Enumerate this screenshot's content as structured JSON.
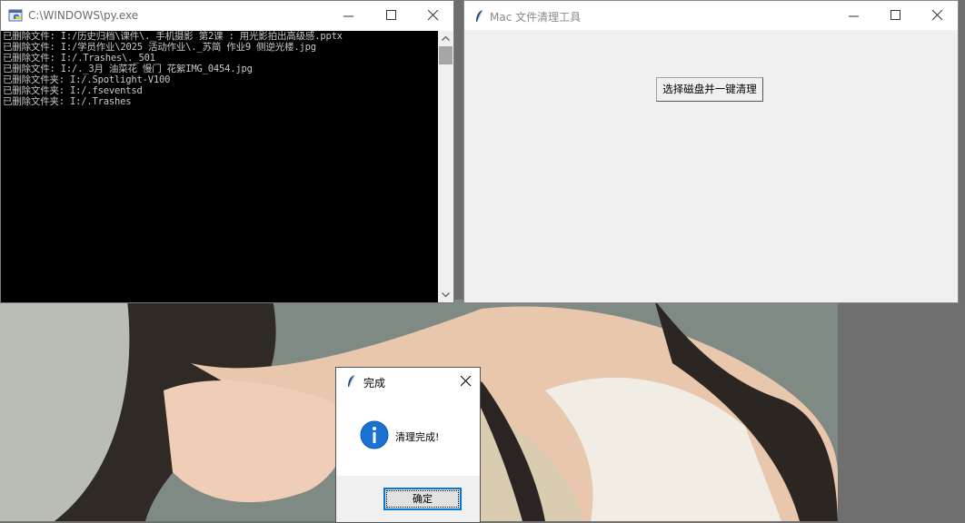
{
  "console": {
    "title": "C:\\WINDOWS\\py.exe",
    "lines": [
      "已删除文件: I:/历史归档\\课件\\._手机摄影 第2课 : 用光影拍出高级感.pptx",
      "已删除文件: I:/学员作业\\2025 活动作业\\._苏简 作业9 侧逆光楼.jpg",
      "已删除文件: I:/.Trashes\\._501",
      "已删除文件: I:/._3月 油菜花 慢门 花絮IMG_0454.jpg",
      "已删除文件夹: I:/.Spotlight-V100",
      "已删除文件夹: I:/.fseventsd",
      "已删除文件夹: I:/.Trashes"
    ],
    "icons": {
      "app": "python-console-icon",
      "minimize": "minimize-icon",
      "maximize": "maximize-icon",
      "close": "close-icon"
    }
  },
  "tool": {
    "title": "Mac 文件清理工具",
    "button_label": "选择磁盘并一键清理",
    "icons": {
      "app": "feather-icon"
    }
  },
  "msgbox": {
    "title": "完成",
    "message": "清理完成!",
    "ok_label": "确定",
    "icons": {
      "app": "feather-icon",
      "info": "info-icon",
      "close": "close-icon"
    },
    "accent_color": "#0078d7"
  }
}
